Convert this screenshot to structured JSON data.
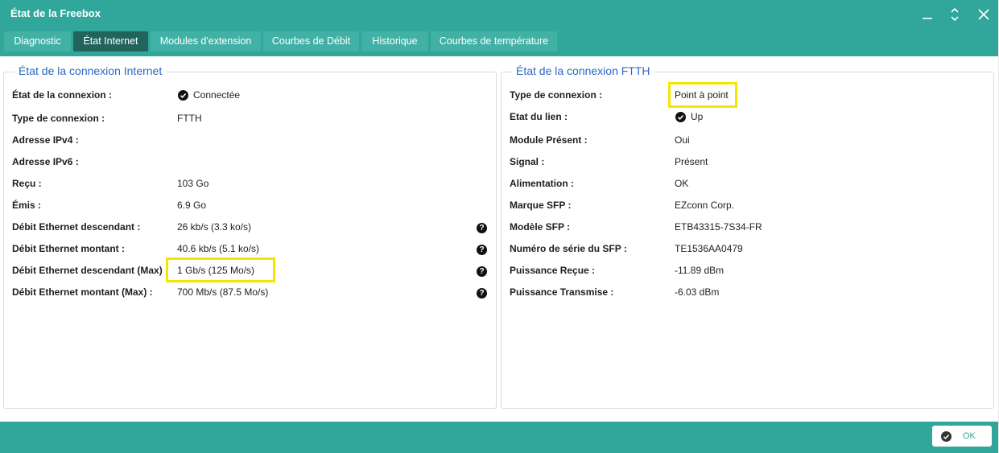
{
  "window": {
    "title": "État de la Freebox"
  },
  "tabs": [
    {
      "label": "Diagnostic"
    },
    {
      "label": "État Internet"
    },
    {
      "label": "Modules d'extension"
    },
    {
      "label": "Courbes de Débit"
    },
    {
      "label": "Historique"
    },
    {
      "label": "Courbes de température"
    }
  ],
  "active_tab": "État Internet",
  "internet": {
    "title": "État de la connexion Internet",
    "rows": [
      {
        "label": "État de la connexion :",
        "value": "Connectée"
      },
      {
        "label": "Type de connexion :",
        "value": "FTTH"
      },
      {
        "label": "Adresse IPv4 :",
        "value": ""
      },
      {
        "label": "Adresse IPv6 :",
        "value": ""
      },
      {
        "label": "Reçu :",
        "value": "103 Go"
      },
      {
        "label": "Émis :",
        "value": "6.9 Go"
      },
      {
        "label": "Débit Ethernet descendant :",
        "value": "26 kb/s (3.3 ko/s)"
      },
      {
        "label": "Débit Ethernet montant :",
        "value": "40.6 kb/s (5.1 ko/s)"
      },
      {
        "label": "Débit Ethernet descendant (Max) :",
        "value": "1 Gb/s (125 Mo/s)"
      },
      {
        "label": "Débit Ethernet montant (Max) :",
        "value": "700 Mb/s (87.5 Mo/s)"
      }
    ],
    "help_glyph": "?"
  },
  "ftth": {
    "title": "État de la connexion FTTH",
    "rows": [
      {
        "label": "Type de connexion :",
        "value": "Point à point"
      },
      {
        "label": "Etat du lien :",
        "value": "Up"
      },
      {
        "label": "Module Présent :",
        "value": "Oui"
      },
      {
        "label": "Signal :",
        "value": "Présent"
      },
      {
        "label": "Alimentation :",
        "value": "OK"
      },
      {
        "label": "Marque SFP :",
        "value": "EZconn Corp."
      },
      {
        "label": "Modèle SFP :",
        "value": "ETB43315-7S34-FR"
      },
      {
        "label": "Numéro de série du SFP :",
        "value": "TE1536AA0479"
      },
      {
        "label": "Puissance Reçue :",
        "value": "-11.89 dBm"
      },
      {
        "label": "Puissance Transmise :",
        "value": "-6.03 dBm"
      }
    ]
  },
  "footer": {
    "ok_label": "OK"
  },
  "colors": {
    "teal": "#31a69a",
    "tab": "#41b1a5",
    "tab_active": "#20645d",
    "section_title": "#2a67c4",
    "highlight": "#f5e600"
  },
  "icons": {
    "minimize": "minimize-icon",
    "maximize": "maximize-icon",
    "close": "close-icon",
    "status_ok": "check-circle-icon",
    "help": "help-circle-icon"
  }
}
